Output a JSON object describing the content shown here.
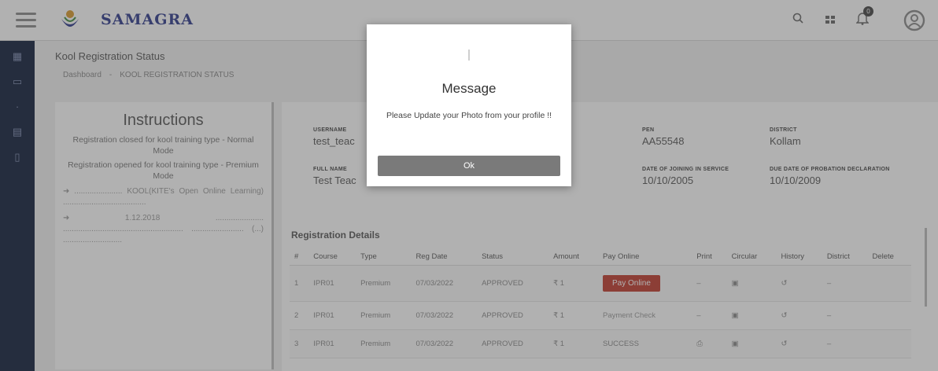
{
  "app": {
    "brand": "SAMAGRA"
  },
  "header": {
    "icons": [
      "search-icon",
      "apps-icon",
      "notifications-icon",
      "account-icon"
    ],
    "notification_count": "0"
  },
  "sidebar": {
    "icons": [
      "dashboard-icon",
      "monitor-icon",
      "item-icon",
      "list-icon",
      "document-icon"
    ]
  },
  "page": {
    "title": "Kool Registration Status",
    "breadcrumb": [
      "Dashboard",
      "KOOL REGISTRATION STATUS"
    ]
  },
  "instructions": {
    "heading": "Instructions",
    "line1": "Registration closed for kool training type - Normal Mode",
    "line2": "Registration opened for kool training type - Premium Mode",
    "para1": "➜ ...................... KOOL(KITE's Open Online Learning) ......................................",
    "para2": "➜ 1.12.2018 ...................... ....................................................... ........................ (...) ..........................."
  },
  "profile": {
    "username_label": "USERNAME",
    "username": "test_teac",
    "fullname_label": "FULL NAME",
    "fullname": "Test Teac",
    "pen_label": "PEN",
    "pen": "AA55548",
    "district_label": "DISTRICT",
    "district": "Kollam",
    "doj_label": "DATE OF JOINING IN SERVICE",
    "doj": "10/10/2005",
    "probation_label": "DUE DATE OF PROBATION DECLARATION",
    "probation": "10/10/2009"
  },
  "registration": {
    "title": "Registration Details",
    "columns": [
      "#",
      "Course",
      "Type",
      "Reg Date",
      "Status",
      "Amount",
      "Pay Online",
      "Print",
      "Circular",
      "History",
      "District",
      "Delete"
    ],
    "rows": [
      {
        "num": "1",
        "course": "IPR01",
        "type": "Premium",
        "date": "07/03/2022",
        "status": "APPROVED",
        "amount": "₹ 1",
        "pay": "Pay Online",
        "print": "–",
        "district": "–"
      },
      {
        "num": "2",
        "course": "IPR01",
        "type": "Premium",
        "date": "07/03/2022",
        "status": "APPROVED",
        "amount": "₹ 1",
        "pay": "Payment Check",
        "print": "–",
        "district": "–"
      },
      {
        "num": "3",
        "course": "IPR01",
        "type": "Premium",
        "date": "07/03/2022",
        "status": "APPROVED",
        "amount": "₹ 1",
        "pay": "SUCCESS",
        "print": "",
        "district": "–"
      }
    ]
  },
  "modal": {
    "title": "Message",
    "message": "Please Update your Photo from your profile !!",
    "ok_label": "Ok"
  }
}
